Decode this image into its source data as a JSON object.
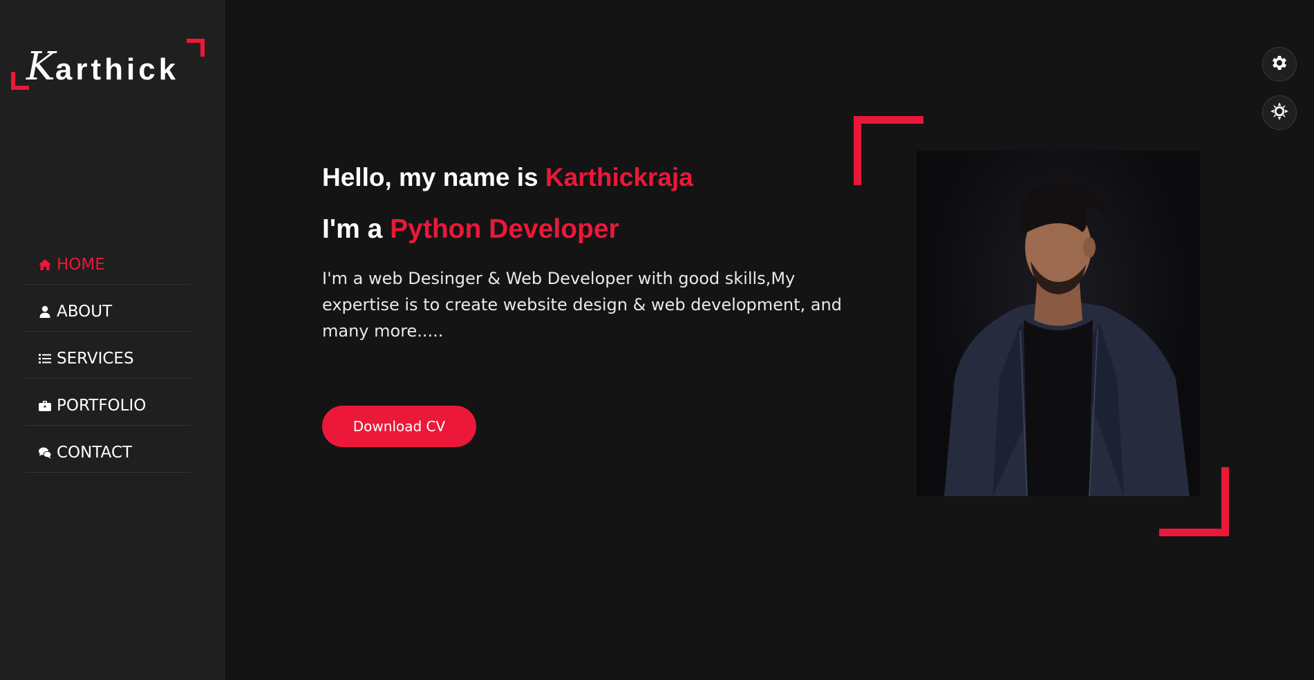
{
  "logo": {
    "initial": "K",
    "rest": "arthick"
  },
  "nav": {
    "items": [
      {
        "label": "HOME",
        "icon": "home-icon",
        "active": true
      },
      {
        "label": "ABOUT",
        "icon": "user-icon",
        "active": false
      },
      {
        "label": "SERVICES",
        "icon": "list-icon",
        "active": false
      },
      {
        "label": "PORTFOLIO",
        "icon": "briefcase-icon",
        "active": false
      },
      {
        "label": "CONTACT",
        "icon": "comments-icon",
        "active": false
      }
    ]
  },
  "hero": {
    "greeting_prefix": "Hello, my name is ",
    "name": "Karthickraja",
    "role_prefix": "I'm a ",
    "role": "Python Developer",
    "description": "I'm a web Desinger & Web Developer with good skills,My expertise is to create website design & web development, and many more.....",
    "cta_label": "Download CV"
  },
  "floating_buttons": [
    {
      "icon": "gear-icon"
    },
    {
      "icon": "sun-icon"
    }
  ],
  "colors": {
    "accent": "#ec1839",
    "background": "#141414",
    "sidebar": "#1f1f1f",
    "text": "#ffffff"
  }
}
